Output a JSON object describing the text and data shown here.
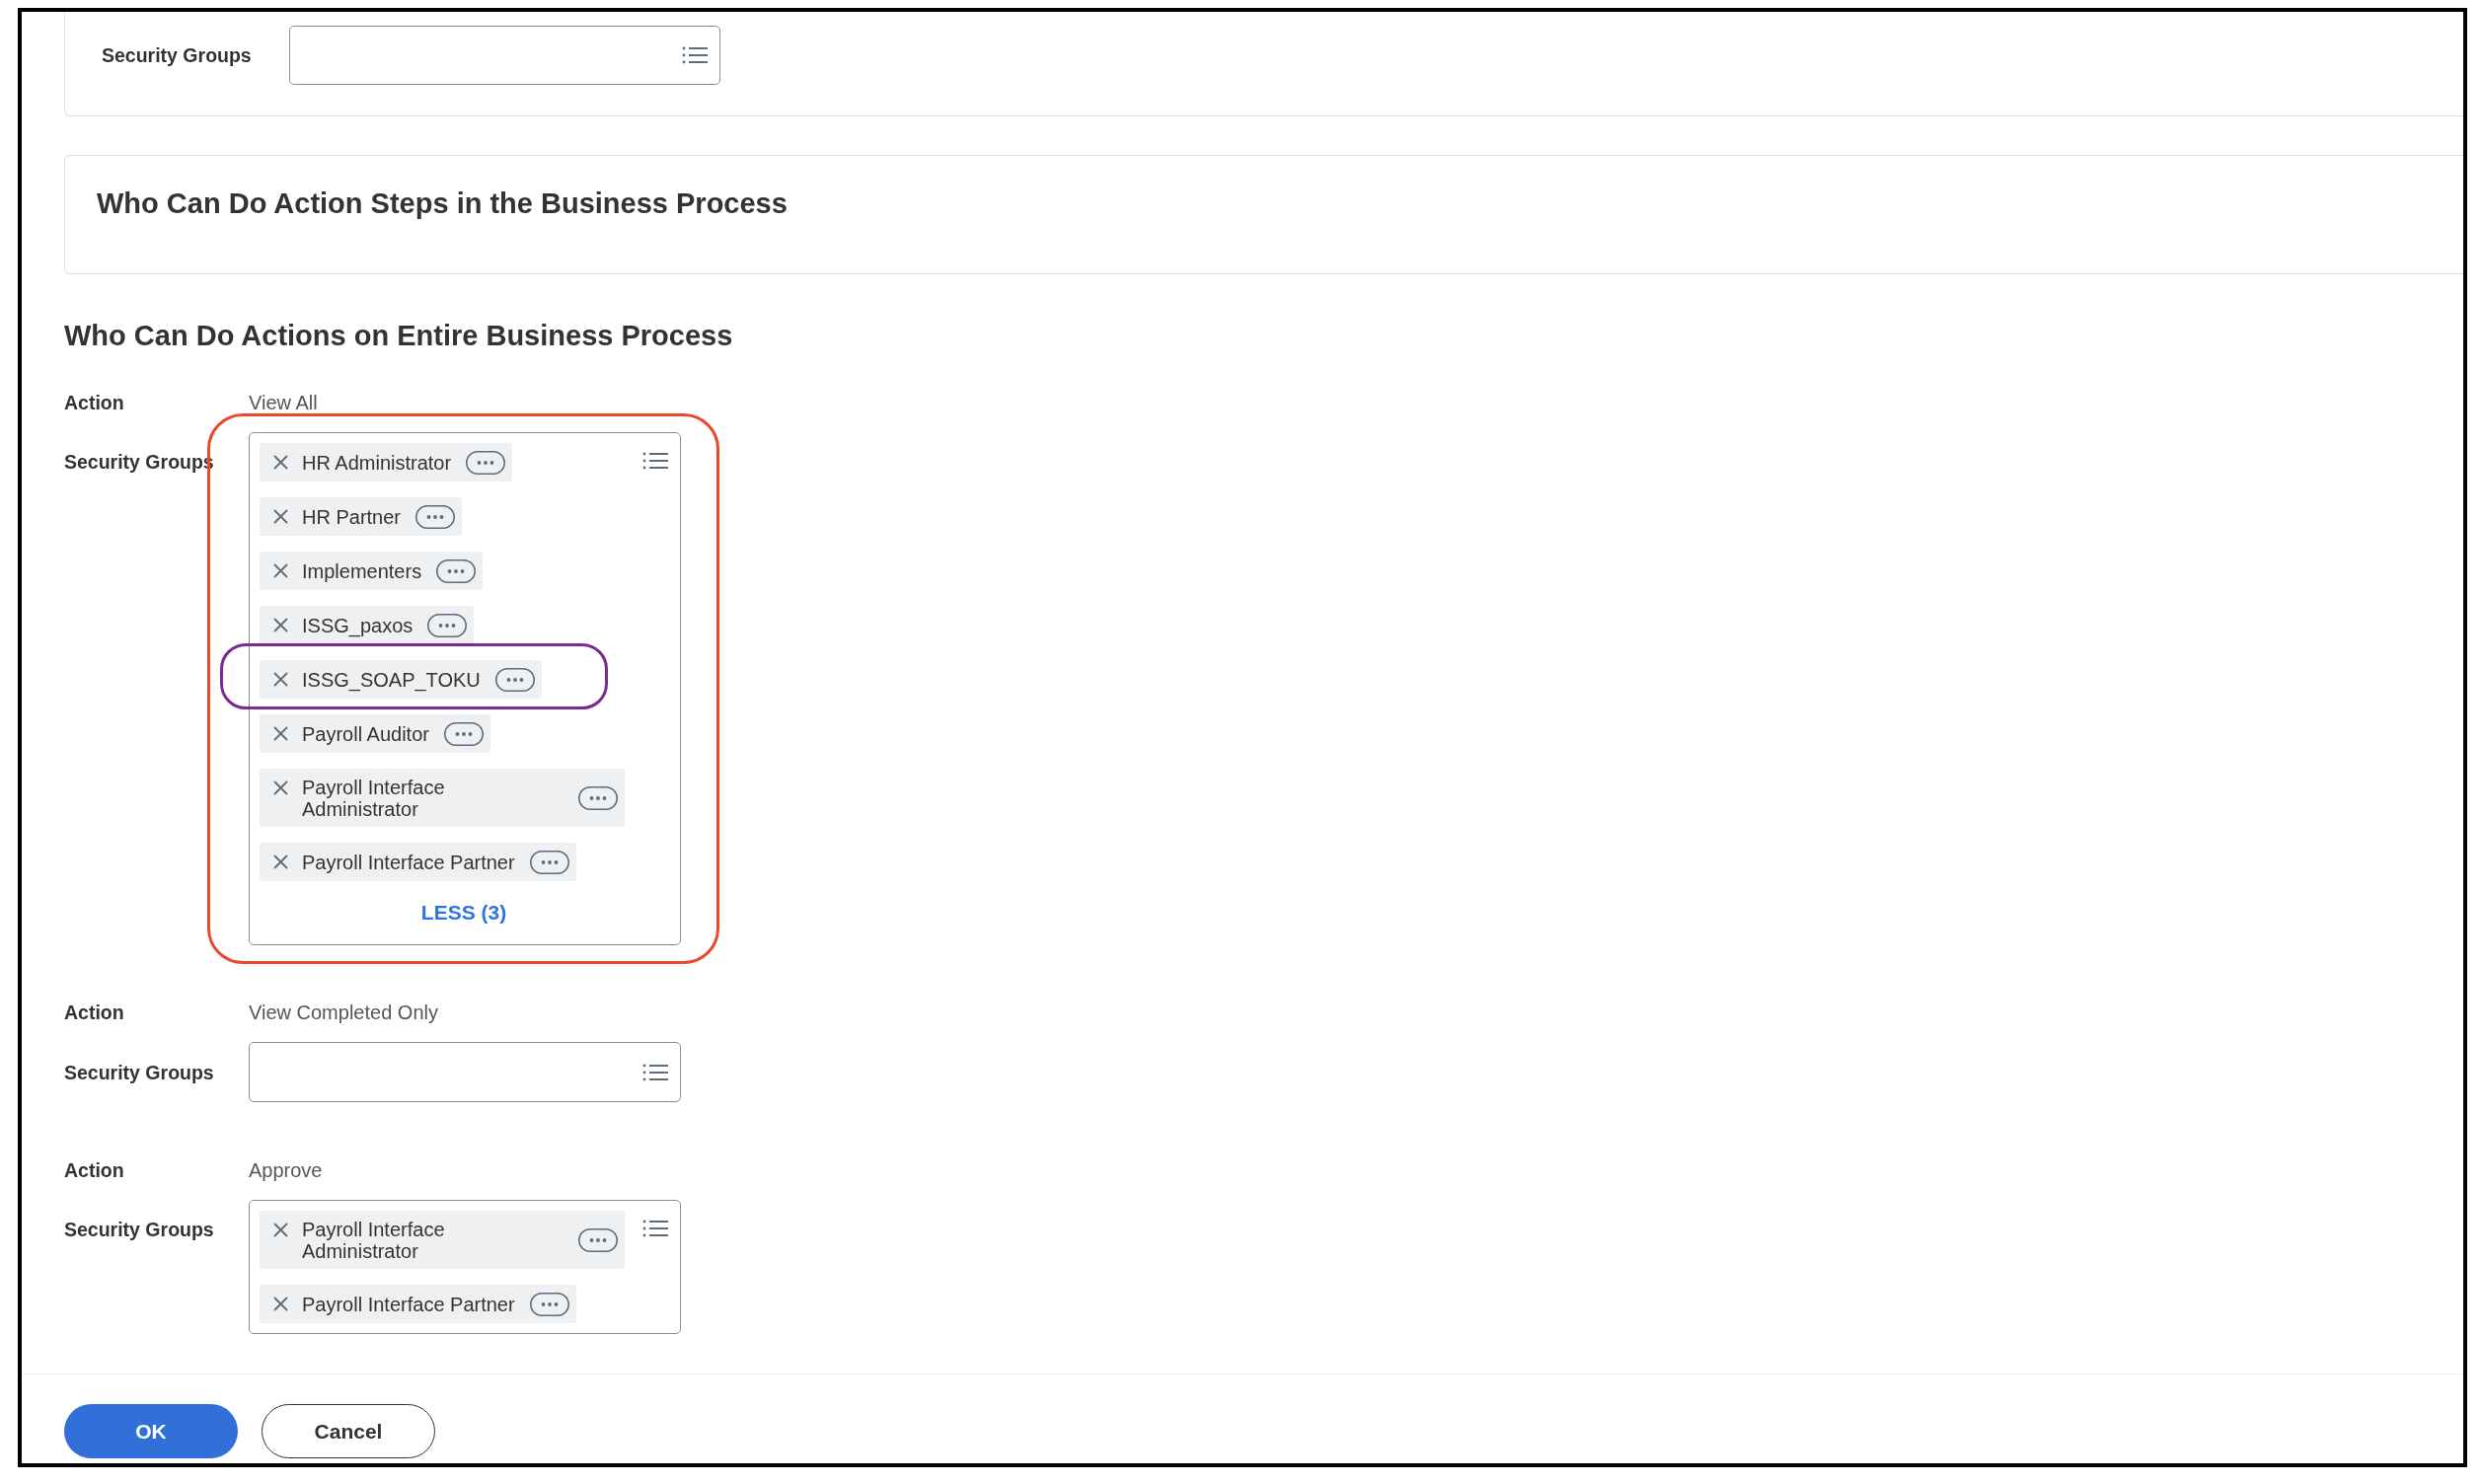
{
  "top_card": {
    "groups_label": "Security Groups"
  },
  "action_steps_card": {
    "title": "Who Can Do Action Steps in the Business Process"
  },
  "entire_process": {
    "title": "Who Can Do Actions on Entire Business Process",
    "rows": [
      {
        "action_label": "Action",
        "action": "View All",
        "groups_label": "Security Groups",
        "highlighted": true,
        "tags": [
          {
            "label": "HR Administrator",
            "highlighted": false
          },
          {
            "label": "HR Partner",
            "highlighted": false
          },
          {
            "label": "Implementers",
            "highlighted": false
          },
          {
            "label": "ISSG_paxos",
            "highlighted": false
          },
          {
            "label": "ISSG_SOAP_TOKU",
            "highlighted": true
          },
          {
            "label": "Payroll Auditor",
            "highlighted": false
          },
          {
            "label": "Payroll Interface Administrator",
            "highlighted": false
          },
          {
            "label": "Payroll Interface Partner",
            "highlighted": false
          }
        ],
        "toggle": "LESS (3)"
      },
      {
        "action_label": "Action",
        "action": "View Completed Only",
        "groups_label": "Security Groups",
        "highlighted": false
      },
      {
        "action_label": "Action",
        "action": "Approve",
        "groups_label": "Security Groups",
        "highlighted": false,
        "tags": [
          {
            "label": "Payroll Interface Administrator",
            "highlighted": false
          },
          {
            "label": "Payroll Interface Partner",
            "highlighted": false
          }
        ]
      }
    ]
  },
  "buttons": [
    {
      "label": "OK",
      "kind": "primary"
    },
    {
      "label": "Cancel",
      "kind": "secondary"
    }
  ]
}
